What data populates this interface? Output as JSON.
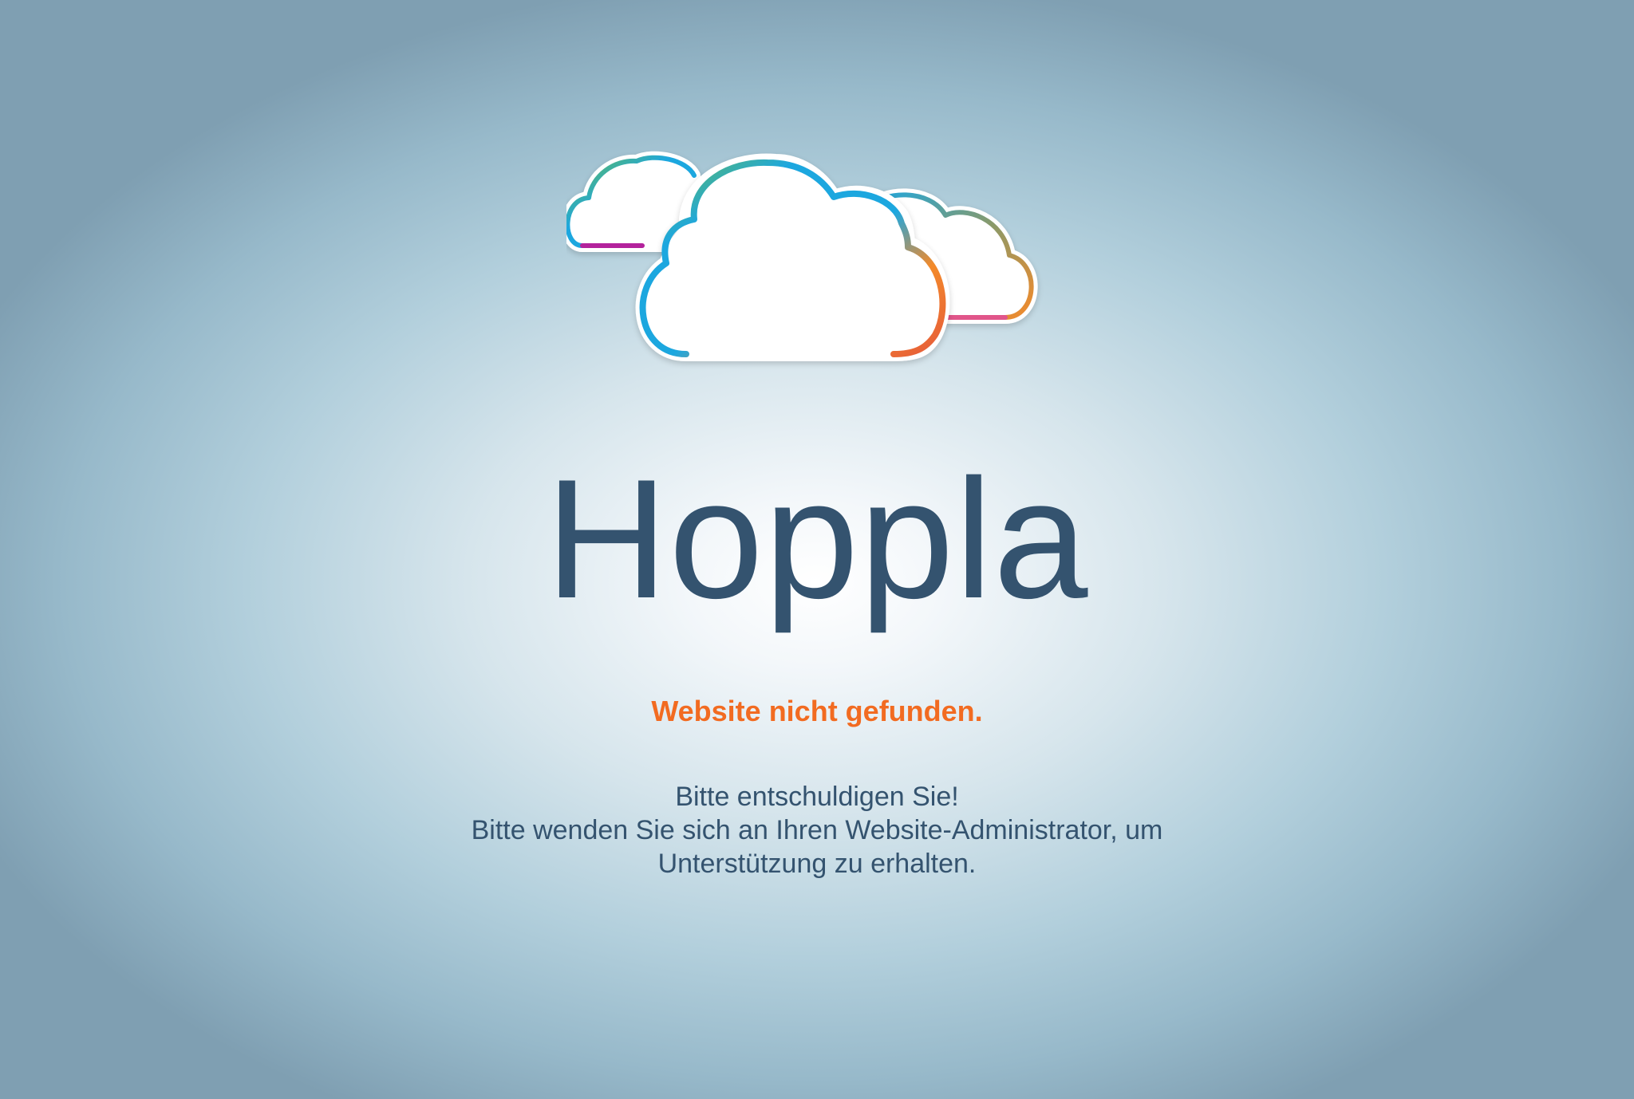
{
  "logo": {
    "icon": "cloud-icon",
    "colors": {
      "blue": "#1ea7df",
      "green": "#6cbd45",
      "magenta": "#b3219c",
      "orange": "#f38a2a",
      "red_orange": "#e65b3a"
    }
  },
  "heading": "Hoppla",
  "error_text": "Website nicht gefunden.",
  "message": {
    "line1": "Bitte entschuldigen Sie!",
    "line2": "Bitte wenden Sie sich an Ihren Website-Administrator, um",
    "line3": "Unterstützung zu erhalten."
  },
  "colors": {
    "heading": "#34536f",
    "error": "#f26b21",
    "message": "#34536f"
  }
}
